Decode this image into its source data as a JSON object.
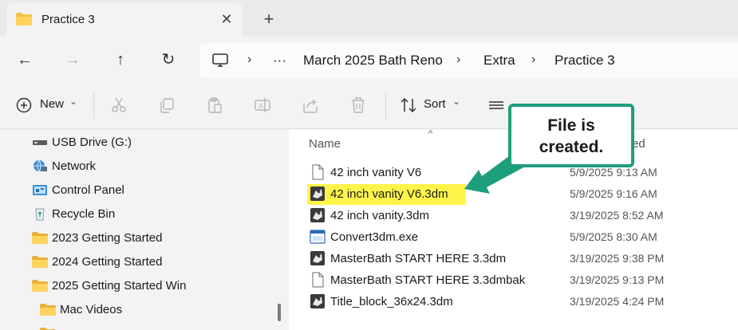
{
  "tab": {
    "title": "Practice 3",
    "close_label": "✕",
    "new_tab_label": "+"
  },
  "nav": {
    "back": "←",
    "forward": "→",
    "up": "↑",
    "refresh": "↻"
  },
  "address": {
    "more": "···",
    "separator": "›",
    "crumbs": [
      "March 2025 Bath Reno",
      "Extra",
      "Practice 3"
    ]
  },
  "toolbar": {
    "new_label": "New",
    "new_chevron": "⌄",
    "sort_label": "Sort",
    "sort_chevron": "⌄",
    "icons": [
      "cut-icon",
      "copy-icon",
      "paste-icon",
      "rename-icon",
      "share-icon",
      "delete-icon",
      "view-icon"
    ]
  },
  "sidebar": {
    "items": [
      {
        "label": "USB Drive (G:)",
        "icon": "usb-drive-icon"
      },
      {
        "label": "Network",
        "icon": "network-icon"
      },
      {
        "label": "Control Panel",
        "icon": "control-panel-icon"
      },
      {
        "label": "Recycle Bin",
        "icon": "recycle-bin-icon"
      },
      {
        "label": "2023 Getting Started",
        "icon": "folder-icon"
      },
      {
        "label": "2024 Getting Started",
        "icon": "folder-icon"
      },
      {
        "label": "2025 Getting Started Win",
        "icon": "folder-icon"
      },
      {
        "label": "Mac Videos",
        "icon": "folder-icon"
      }
    ]
  },
  "filelist": {
    "columns": {
      "name": "Name",
      "sort_caret": "^",
      "date": "ed"
    },
    "rows": [
      {
        "name": "42 inch vanity V6",
        "date": "5/9/2025 9:13 AM",
        "icon": "generic-file-icon"
      },
      {
        "name": "42 inch vanity V6.3dm",
        "date": "5/9/2025 9:16 AM",
        "icon": "rhino-file-icon"
      },
      {
        "name": "42 inch vanity.3dm",
        "date": "3/19/2025 8:52 AM",
        "icon": "rhino-file-icon"
      },
      {
        "name": "Convert3dm.exe",
        "date": "5/9/2025 8:30 AM",
        "icon": "exe-file-icon"
      },
      {
        "name": "MasterBath START HERE 3.3dm",
        "date": "3/19/2025 9:38 PM",
        "icon": "rhino-file-icon"
      },
      {
        "name": "MasterBath START HERE 3.3dmbak",
        "date": "3/19/2025 9:13 PM",
        "icon": "generic-file-icon"
      },
      {
        "name": "Title_block_36x24.3dm",
        "date": "3/19/2025 4:24 PM",
        "icon": "rhino-file-icon"
      }
    ]
  },
  "callout": {
    "line1": "File is",
    "line2": "created."
  },
  "colors": {
    "highlight": "#fff54a",
    "callout_border": "#1f9e7b",
    "folder": "#f2c04b"
  }
}
